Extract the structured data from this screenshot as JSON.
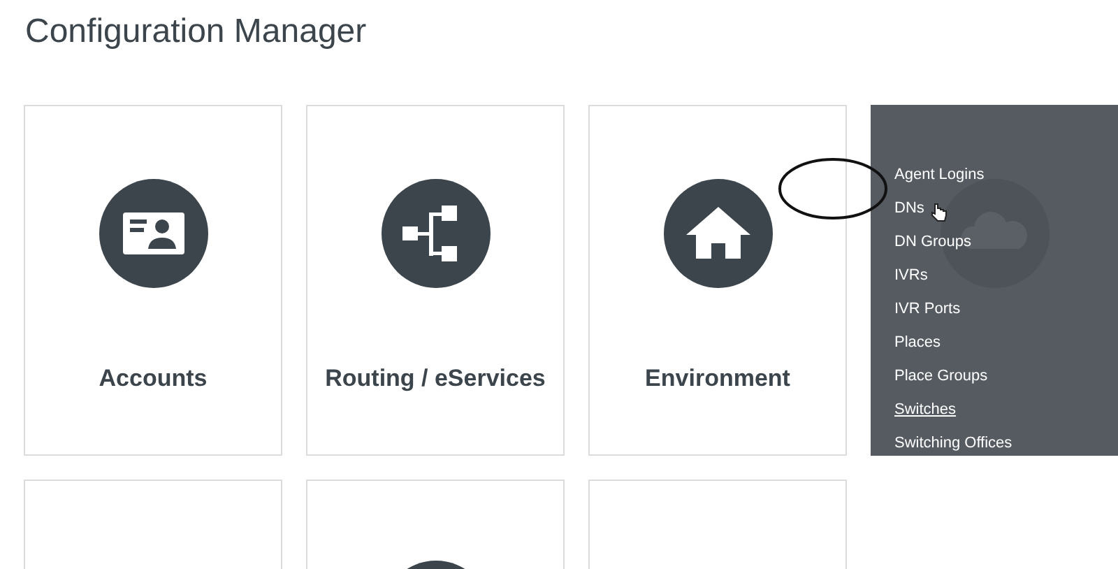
{
  "page": {
    "title": "Configuration Manager"
  },
  "tiles": [
    {
      "label": "Accounts",
      "hovered": false
    },
    {
      "label": "Routing / eServices",
      "hovered": false
    },
    {
      "label": "Environment",
      "hovered": false
    },
    {
      "hovered": true,
      "menu": [
        {
          "label": "Agent Logins",
          "underlined": false
        },
        {
          "label": "DNs",
          "underlined": false
        },
        {
          "label": "DN Groups",
          "underlined": false
        },
        {
          "label": "IVRs",
          "underlined": false
        },
        {
          "label": "IVR Ports",
          "underlined": false
        },
        {
          "label": "Places",
          "underlined": false
        },
        {
          "label": "Place Groups",
          "underlined": false
        },
        {
          "label": "Switches",
          "underlined": true
        },
        {
          "label": "Switching Offices",
          "underlined": false
        }
      ]
    },
    {
      "hovered": false
    },
    {
      "hovered": false
    },
    {
      "hovered": false
    }
  ]
}
